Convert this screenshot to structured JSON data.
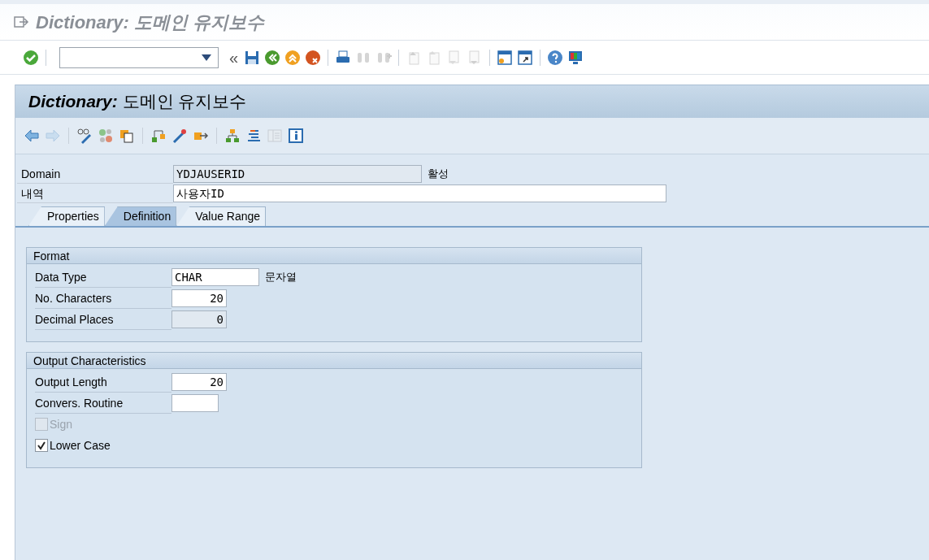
{
  "window": {
    "title": "Dictionary: 도메인 유지보수"
  },
  "system_toolbar": {
    "buttons": [
      {
        "disabled": false
      },
      {
        "disabled": false
      },
      {
        "disabled": false
      },
      {
        "disabled": false
      },
      {
        "disabled": false
      },
      {
        "disabled": false
      },
      {
        "disabled": true
      },
      {
        "disabled": true
      },
      {
        "disabled": true
      },
      {
        "disabled": true
      },
      {
        "disabled": true
      },
      {
        "disabled": true
      },
      {
        "disabled": false
      },
      {
        "disabled": false
      },
      {
        "disabled": false
      },
      {
        "disabled": false
      }
    ],
    "command_field": {
      "expanded": false
    },
    "collapse_glyph": "«"
  },
  "screen": {
    "title_prefix": "Dictionary:",
    "title_rest": "도메인 유지보수"
  },
  "app_toolbar": {
    "buttons": [
      {
        "disabled": false
      },
      {
        "disabled": true
      },
      {
        "disabled": false
      },
      {
        "disabled": false
      },
      {
        "disabled": false
      },
      {
        "disabled": false
      },
      {
        "disabled": false
      },
      {
        "disabled": false
      },
      {
        "disabled": false
      },
      {
        "disabled": false
      },
      {
        "disabled": true
      },
      {
        "disabled": false
      }
    ]
  },
  "header_fields": [
    {
      "label": "Domain",
      "value": "YDJAUSERID",
      "disabled": true,
      "status": "활성"
    },
    {
      "label": "내역",
      "value": "사용자ID",
      "disabled": false
    }
  ],
  "tabs": [
    {
      "label": "Properties",
      "selected": false
    },
    {
      "label": "Definition",
      "selected": true
    },
    {
      "label": "Value Range",
      "selected": false
    }
  ],
  "groups": [
    {
      "title": "Format",
      "rows": [
        {
          "kind": "text",
          "label": "Data Type",
          "value": "CHAR",
          "disabled": false,
          "note": "문자열"
        },
        {
          "kind": "number",
          "label": "No. Characters",
          "value": "20",
          "disabled": false
        },
        {
          "kind": "number",
          "label": "Decimal Places",
          "value": "0",
          "disabled": true
        }
      ]
    },
    {
      "title": "Output Characteristics",
      "rows": [
        {
          "kind": "number",
          "label": "Output Length",
          "value": "20",
          "disabled": false
        },
        {
          "kind": "text",
          "label": "Convers. Routine",
          "value": "",
          "disabled": false
        },
        {
          "kind": "checkbox",
          "label": "Sign",
          "checked": false,
          "disabled": true
        },
        {
          "kind": "checkbox",
          "label": "Lower Case",
          "checked": true,
          "disabled": false
        }
      ]
    }
  ]
}
